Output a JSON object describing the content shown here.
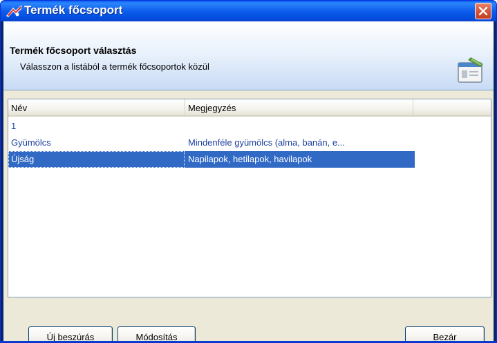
{
  "window": {
    "title": "Termék főcsoport"
  },
  "header": {
    "title": "Termék főcsoport választás",
    "subtitle": "Válasszon a listából a termék főcsoportok közül"
  },
  "list": {
    "columns": [
      "Név",
      "Megjegyzés",
      ""
    ],
    "rows": [
      {
        "name": "1",
        "note": "",
        "selected": false
      },
      {
        "name": "Gyümölcs",
        "note": "Mindenféle gyümölcs (alma, banán, e...",
        "selected": false
      },
      {
        "name": "Újság",
        "note": "Napilapok, hetilapok, havilapok",
        "selected": true
      }
    ]
  },
  "buttons": {
    "new_label": "Új beszúrás",
    "edit_label": "Módosítás",
    "close_label": "Bezár"
  },
  "colors": {
    "titlebar": "#0f5ded",
    "selection": "#316ac5",
    "close_button": "#d7553a",
    "row_text": "#1c3fa0"
  },
  "icons": {
    "app": "app-logo-icon",
    "close": "close-icon",
    "header": "window-form-icon"
  }
}
